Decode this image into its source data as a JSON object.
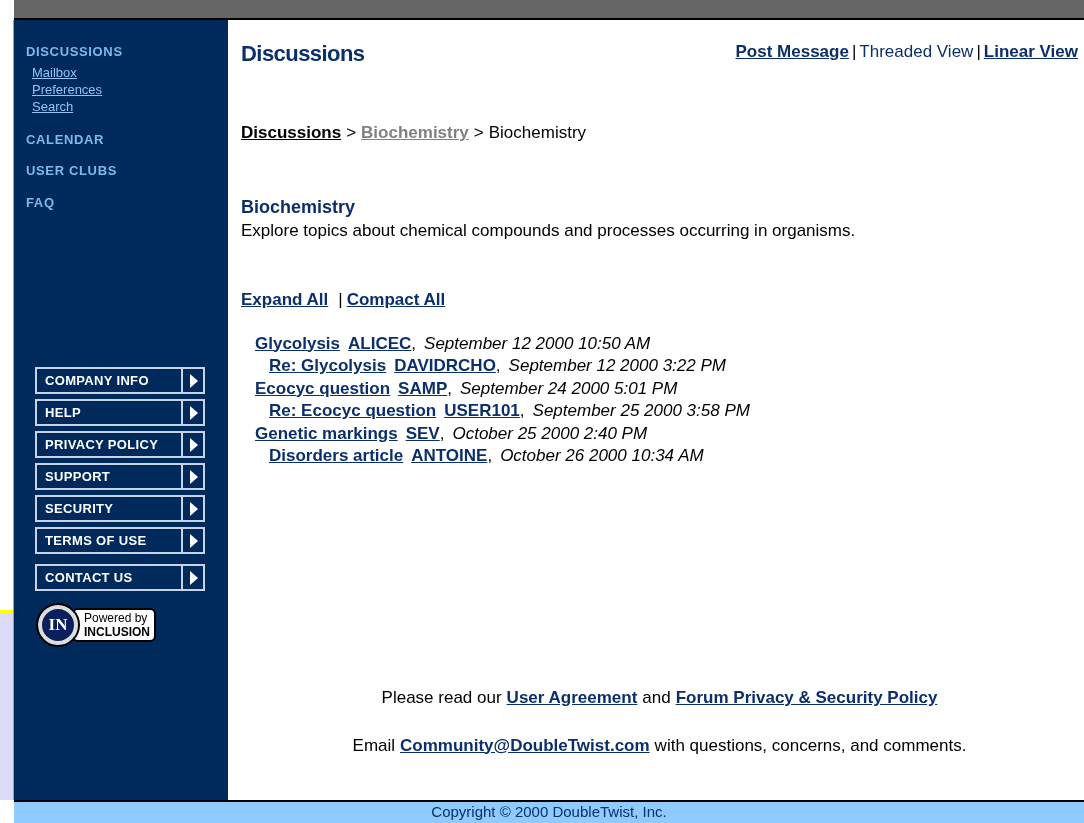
{
  "sidebar": {
    "section_title": "DISCUSSIONS",
    "sub_links": [
      "Mailbox",
      "Preferences",
      "Search"
    ],
    "sections": [
      "CALENDAR",
      "USER CLUBS",
      "FAQ"
    ],
    "nav_groups": [
      [
        "COMPANY INFO",
        "HELP",
        "PRIVACY POLICY",
        "SUPPORT",
        "SECURITY",
        "TERMS OF USE"
      ],
      [
        "CONTACT US"
      ]
    ],
    "badge": {
      "mark": "IN",
      "line1": "Powered by",
      "line2": "INCLUSION"
    }
  },
  "page_title": "Discussions",
  "view_links": [
    {
      "label": "Post Message",
      "kind": "link"
    },
    {
      "label": "|",
      "kind": "separator"
    },
    {
      "label": "Threaded View",
      "kind": "current"
    },
    {
      "label": "|",
      "kind": "separator"
    },
    {
      "label": "Linear View",
      "kind": "link"
    }
  ],
  "breadcrumb": [
    {
      "label": "Discussions",
      "kind": "link"
    },
    {
      "label": ">",
      "kind": "separator"
    },
    {
      "label": "Biochemistry",
      "kind": "visited"
    },
    {
      "label": ">",
      "kind": "separator"
    },
    {
      "label": "Biochemistry",
      "kind": "current"
    }
  ],
  "forum": {
    "title": "Biochemistry",
    "description": "Explore topics about chemical compounds and processes occurring in organisms."
  },
  "expand_links": [
    {
      "label": "Expand All",
      "kind": "link"
    },
    {
      "label": "|",
      "kind": "separator"
    },
    {
      "label": "Compact All",
      "kind": "link"
    }
  ],
  "threads": [
    {
      "subject": "Glycolysis",
      "author": "ALICEC",
      "punctuation": ",",
      "date": "September 12 2000 10:50 AM",
      "children": [
        {
          "subject": "Re: Glycolysis",
          "author": "DAVIDRCHO",
          "punctuation": ",",
          "date": "September 12 2000 3:22 PM"
        }
      ]
    },
    {
      "subject": "Ecocyc question",
      "author": "SAMP",
      "punctuation": ",",
      "date": "September 24 2000 5:01 PM",
      "children": [
        {
          "subject": "Re: Ecocyc question",
          "author": "USER101",
          "punctuation": ",",
          "date": "September 25 2000 3:58 PM"
        }
      ]
    },
    {
      "subject": "Genetic markings",
      "author": "SEV",
      "punctuation": ",",
      "date": "October 25 2000 2:40 PM",
      "children": [
        {
          "subject": "Disorders article",
          "author": "ANTOINE",
          "punctuation": ",",
          "date": "October 26 2000 10:34 AM"
        }
      ]
    }
  ],
  "footer_lines": [
    [
      {
        "text": "Please read our",
        "kind": "text"
      },
      {
        "text": "User Agreement",
        "kind": "link"
      },
      {
        "text": "and",
        "kind": "text"
      },
      {
        "text": "Forum Privacy & Security Policy",
        "kind": "link"
      }
    ],
    [
      {
        "text": "Email",
        "kind": "text"
      },
      {
        "text": "Community@DoubleTwist.com",
        "kind": "link"
      },
      {
        "text": "with questions, concerns, and comments.",
        "kind": "text"
      }
    ]
  ],
  "copyright": "Copyright © 2000 DoubleTwist, Inc."
}
